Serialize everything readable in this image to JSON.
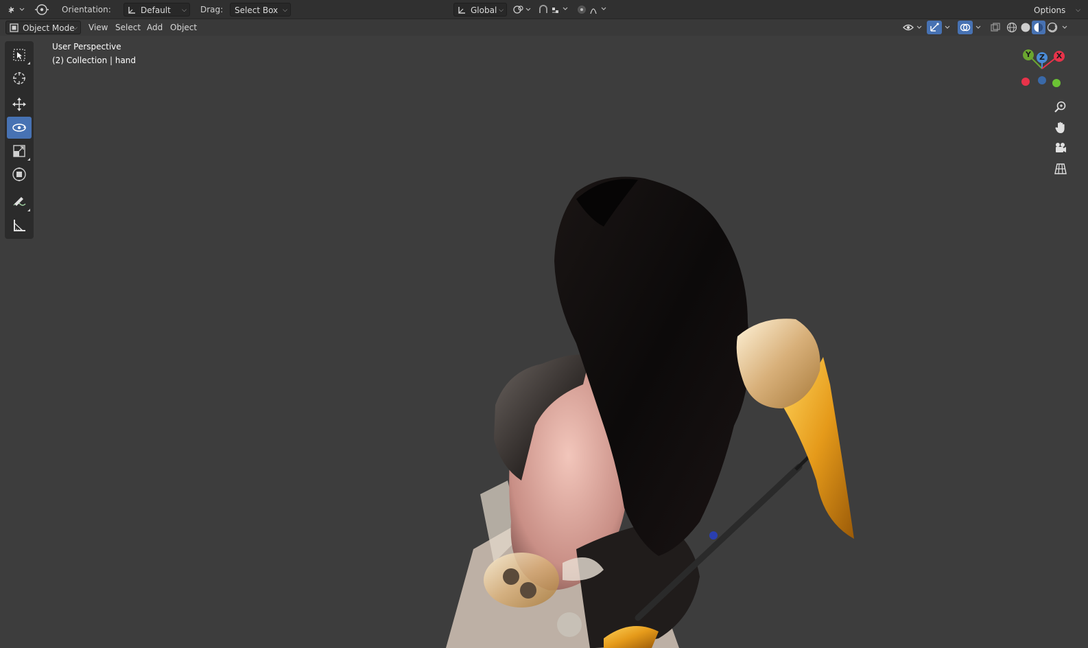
{
  "header": {
    "orientation_label": "Orientation:",
    "orientation_value": "Default",
    "drag_label": "Drag:",
    "drag_value": "Select Box",
    "transform_orientation": "Global",
    "options_label": "Options"
  },
  "menubar": {
    "mode": "Object Mode",
    "items": [
      "View",
      "Select",
      "Add",
      "Object"
    ]
  },
  "viewport": {
    "perspective": "User Perspective",
    "collection": "(2) Collection | hand"
  },
  "gizmo": {
    "axes": [
      "Y",
      "Z",
      "X"
    ],
    "colors": {
      "x": "#e8334a",
      "y": "#6ba630",
      "z": "#4a8bd6"
    }
  },
  "toolbar": {
    "tools": [
      "select-box",
      "cursor",
      "move",
      "rotate",
      "scale",
      "transform",
      "annotate",
      "measure"
    ],
    "active_tool": "rotate"
  },
  "icons": {
    "editor_type": "editor-type-icon",
    "object_origin": "object-origin-icon",
    "snap": "snap-icon",
    "proportional": "proportional-editing-icon",
    "visibility": "visibility-icon",
    "gizmo_toggle": "gizmo-icon",
    "overlay": "overlay-icon",
    "xray": "xray-icon",
    "shading": [
      "wireframe-shading-icon",
      "solid-shading-icon",
      "material-shading-icon",
      "rendered-shading-icon"
    ],
    "navigation": [
      "zoom-icon",
      "pan-hand-icon",
      "camera-icon",
      "grid-icon"
    ]
  },
  "colors": {
    "viewport_bg": "#3d3d3d",
    "header_bg": "#303030",
    "accent": "#4772b3"
  }
}
